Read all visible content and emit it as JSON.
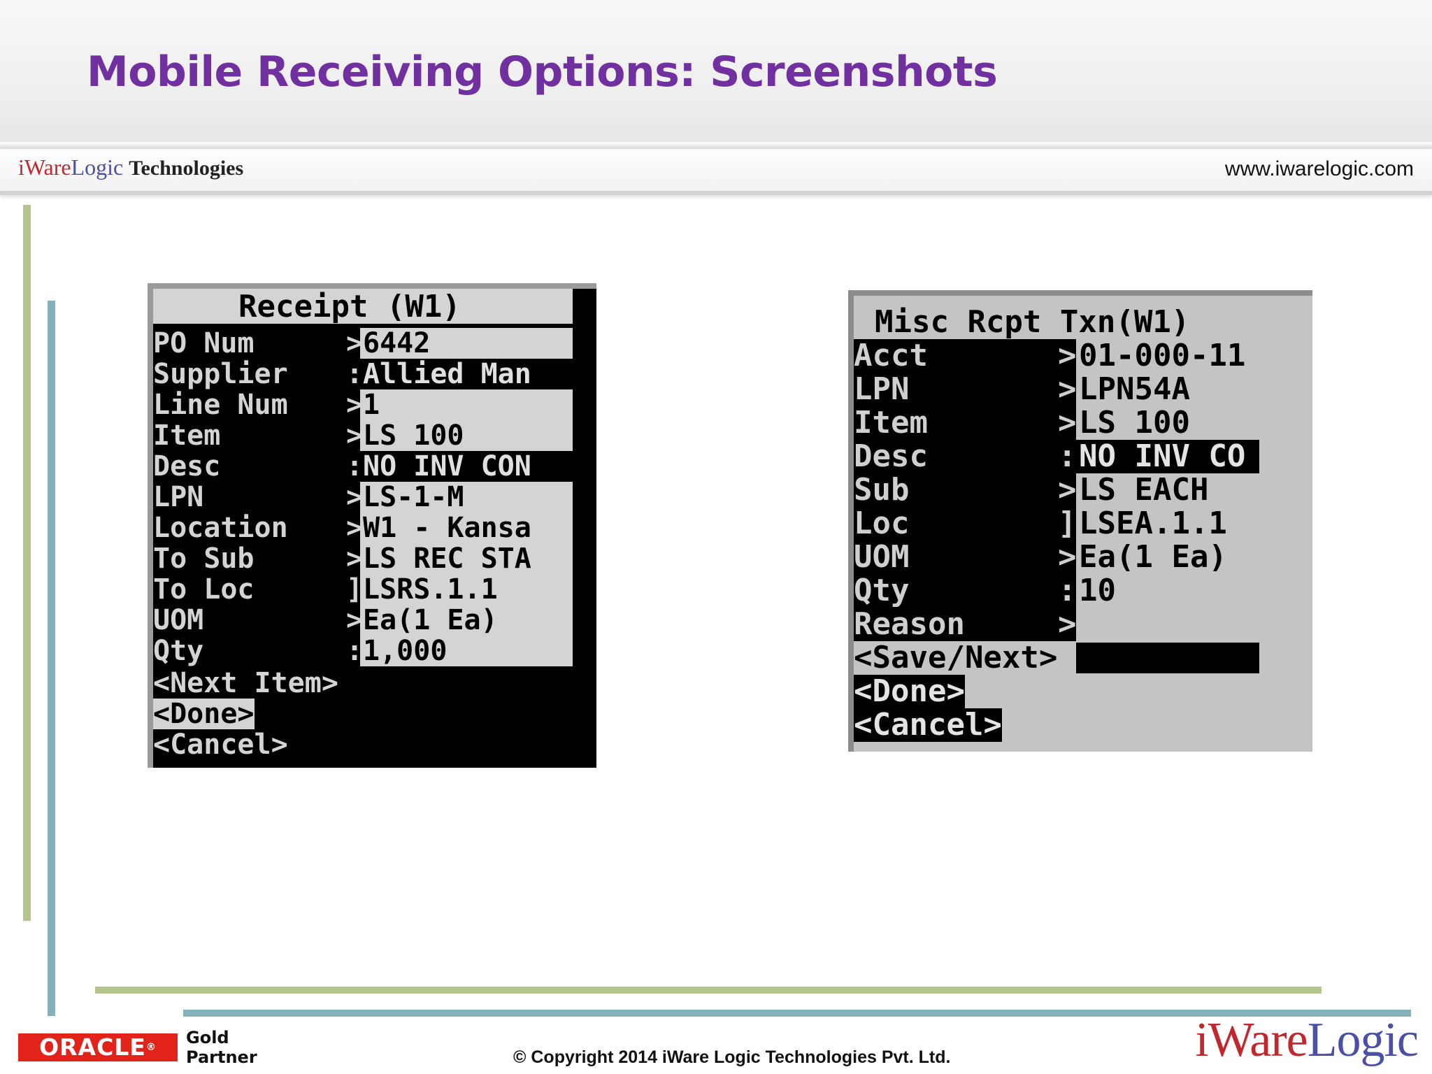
{
  "slide": {
    "title": "Mobile Receiving Options: Screenshots"
  },
  "brand": {
    "logo_i_ware": "iWare",
    "logo_logic": "Logic",
    "logo_suffix": "Technologies",
    "url": "www.iwarelogic.com"
  },
  "colors": {
    "title": "#7030a0",
    "accent_green": "#b3c58a",
    "accent_teal": "#85b1bb",
    "oracle_red": "#e2231a",
    "logo_red": "#c0282d",
    "logo_blue": "#4a4fa8"
  },
  "receipt_screen": {
    "title": "Receipt (W1)",
    "fields": [
      {
        "label": "PO Num",
        "sep": ">",
        "value": "6442",
        "inverted": false
      },
      {
        "label": "Supplier",
        "sep": ":",
        "value": "Allied Man",
        "inverted": true
      },
      {
        "label": "Line Num",
        "sep": ">",
        "value": "1",
        "inverted": false
      },
      {
        "label": "Item",
        "sep": ">",
        "value": "LS 100",
        "inverted": false
      },
      {
        "label": "Desc",
        "sep": ":",
        "value": "NO INV CON",
        "inverted": true
      },
      {
        "label": "LPN",
        "sep": ">",
        "value": "LS-1-M",
        "inverted": false
      },
      {
        "label": "Location",
        "sep": ">",
        "value": "W1 - Kansa",
        "inverted": false
      },
      {
        "label": "To Sub",
        "sep": ">",
        "value": "LS REC STA",
        "inverted": false
      },
      {
        "label": "To Loc",
        "sep": "]",
        "value": "LSRS.1.1",
        "inverted": false
      },
      {
        "label": "UOM",
        "sep": ">",
        "value": "Ea(1 Ea)",
        "inverted": false
      },
      {
        "label": "Qty",
        "sep": ":",
        "value": "1,000",
        "inverted": false
      }
    ],
    "actions": [
      {
        "label": "<Next Item>",
        "selected": false
      },
      {
        "label": "<Done>",
        "selected": true
      },
      {
        "label": "<Cancel>",
        "selected": false
      }
    ]
  },
  "misc_screen": {
    "title": "Misc Rcpt Txn(W1)",
    "fields": [
      {
        "label": "Acct",
        "sep": ">",
        "value": "01-000-11",
        "inverted": false
      },
      {
        "label": "LPN",
        "sep": ">",
        "value": "LPN54A",
        "inverted": false
      },
      {
        "label": "Item",
        "sep": ">",
        "value": "LS 100",
        "inverted": false
      },
      {
        "label": "Desc",
        "sep": ":",
        "value": "NO INV CO",
        "inverted": true
      },
      {
        "label": "Sub",
        "sep": ">",
        "value": "LS EACH",
        "inverted": false
      },
      {
        "label": "Loc",
        "sep": "]",
        "value": "LSEA.1.1",
        "inverted": false
      },
      {
        "label": "UOM",
        "sep": ">",
        "value": "Ea(1 Ea)",
        "inverted": false
      },
      {
        "label": "Qty",
        "sep": ":",
        "value": "10",
        "inverted": false
      },
      {
        "label": "Reason",
        "sep": ">",
        "value": "",
        "inverted": false
      }
    ],
    "actions": [
      {
        "label": "<Save/Next>",
        "selected": false
      },
      {
        "label": "<Done>",
        "selected": true
      },
      {
        "label": "<Cancel>",
        "selected": true
      }
    ]
  },
  "footer": {
    "oracle": "ORACLE",
    "registered": "®",
    "partner_level": "Gold",
    "partner": "Partner",
    "copyright": "© Copyright 2014 iWare Logic Technologies Pvt. Ltd.",
    "logo_i_ware": "iWare",
    "logo_logic": "Logic"
  }
}
